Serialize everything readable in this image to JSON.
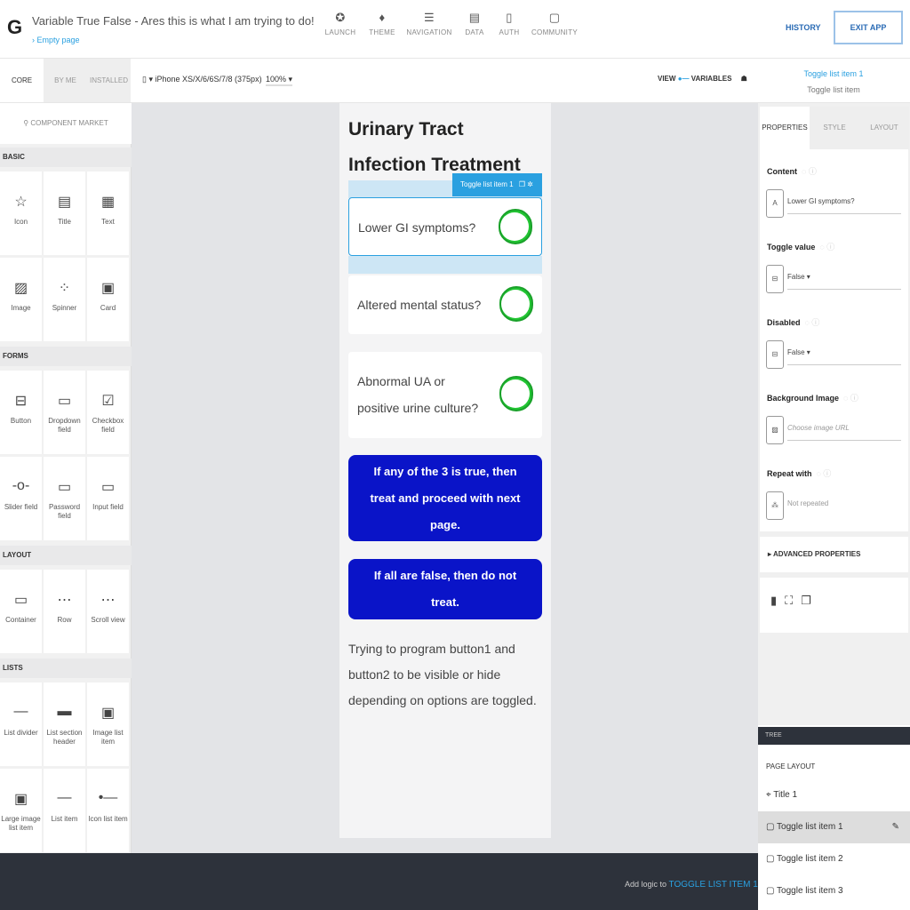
{
  "header": {
    "app_title": "Variable True False - Ares this is what I am trying to do!",
    "breadcrumb": "› Empty page",
    "nav": [
      {
        "label": "LAUNCH",
        "icon": "rocket-icon",
        "glyph": "✪"
      },
      {
        "label": "THEME",
        "icon": "brush-icon",
        "glyph": "♦"
      },
      {
        "label": "NAVIGATION",
        "icon": "list-icon",
        "glyph": "☰"
      },
      {
        "label": "DATA",
        "icon": "database-icon",
        "glyph": "▤"
      },
      {
        "label": "AUTH",
        "icon": "lock-icon",
        "glyph": "▯"
      },
      {
        "label": "COMMUNITY",
        "icon": "chat-icon",
        "glyph": "▢"
      }
    ],
    "history": "HISTORY",
    "exit": "EXIT APP"
  },
  "toolbar": {
    "tabs": [
      "CORE",
      "BY ME",
      "INSTALLED"
    ],
    "device": "iPhone XS/X/6/6S/7/8 (375px)",
    "zoom": "100% ▾",
    "view": "VIEW",
    "variables": "VARIABLES",
    "selected_name": "Toggle list item 1",
    "selected_type": "Toggle list item"
  },
  "sidebar": {
    "market": "COMPONENT MARKET",
    "sections": [
      {
        "title": "BASIC",
        "items": [
          {
            "label": "Icon",
            "glyph": "☆"
          },
          {
            "label": "Title",
            "glyph": "▤"
          },
          {
            "label": "Text",
            "glyph": "▦"
          },
          {
            "label": "Image",
            "glyph": "▨"
          },
          {
            "label": "Spinner",
            "glyph": "⁘"
          },
          {
            "label": "Card",
            "glyph": "▣"
          }
        ]
      },
      {
        "title": "FORMS",
        "items": [
          {
            "label": "Button",
            "glyph": "⊟"
          },
          {
            "label": "Dropdown field",
            "glyph": "▭"
          },
          {
            "label": "Checkbox field",
            "glyph": "☑"
          },
          {
            "label": "Slider field",
            "glyph": "-o-"
          },
          {
            "label": "Password field",
            "glyph": "▭"
          },
          {
            "label": "Input field",
            "glyph": "▭"
          }
        ]
      },
      {
        "title": "LAYOUT",
        "items": [
          {
            "label": "Container",
            "glyph": "▭"
          },
          {
            "label": "Row",
            "glyph": "⋯"
          },
          {
            "label": "Scroll view",
            "glyph": "⋯"
          }
        ]
      },
      {
        "title": "LISTS",
        "items": [
          {
            "label": "List divider",
            "glyph": "—"
          },
          {
            "label": "List section header",
            "glyph": "▬"
          },
          {
            "label": "Image list item",
            "glyph": "▣"
          },
          {
            "label": "Large image list item",
            "glyph": "▣"
          },
          {
            "label": "List item",
            "glyph": "—"
          },
          {
            "label": "Icon list item",
            "glyph": "•—"
          }
        ]
      }
    ]
  },
  "phone": {
    "title": "Urinary Tract Infection Treatment",
    "tag": "Toggle list item 1",
    "items": [
      {
        "label": "Lower GI symptoms?",
        "on": true
      },
      {
        "label": "Altered mental status?",
        "on": true
      },
      {
        "label": "Abnormal UA or positive urine culture?",
        "on": true
      }
    ],
    "button1": "If any of the 3 is true, then treat and proceed with next page.",
    "button2": "If all are false, then do not treat.",
    "note": "Trying to program button1 and button2 to be visible or hide depending on options are toggled.",
    "toggle_color": "#22c533",
    "button_color": "#0a14c8"
  },
  "bottom": {
    "add_logic": "Add logic to",
    "target": "TOGGLE LIST ITEM 1"
  },
  "right": {
    "tabs": [
      "PROPERTIES",
      "STYLE",
      "LAYOUT"
    ],
    "props": [
      {
        "label": "Content",
        "value": "Lower GI symptoms?"
      },
      {
        "label": "Toggle value",
        "value": "False ▾"
      },
      {
        "label": "Disabled",
        "value": "False ▾"
      },
      {
        "label": "Background Image",
        "value": "Choose image URL"
      },
      {
        "label": "Repeat with",
        "value": "Not repeated"
      }
    ],
    "advanced": "▸ ADVANCED PROPERTIES",
    "tree_header": "TREE",
    "page_layout": "PAGE LAYOUT",
    "tree": [
      "⌖ Title 1",
      "▢ Toggle list item 1",
      "▢ Toggle list item 2",
      "▢ Toggle list item 3"
    ]
  }
}
